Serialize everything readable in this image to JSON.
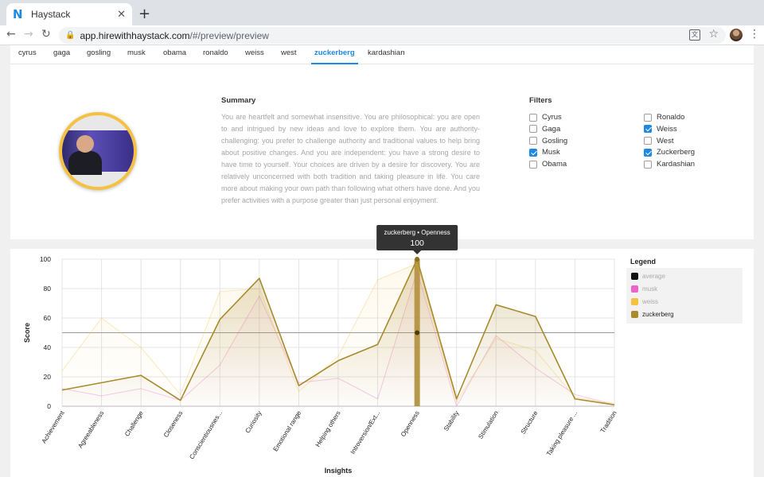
{
  "browser": {
    "tab_title": "Haystack",
    "tab_favicon": "N",
    "url_host": "app.hirewithhaystack.com",
    "url_path": "/#/preview/preview"
  },
  "celebrity_tabs": [
    "cyrus",
    "gaga",
    "gosling",
    "musk",
    "obama",
    "ronaldo",
    "weiss",
    "west",
    "zuckerberg",
    "kardashian"
  ],
  "active_tab": "zuckerberg",
  "summary": {
    "heading": "Summary",
    "text": "You are heartfelt and somewhat insensitive. You are philosophical: you are open to and intrigued by new ideas and love to explore them. You are authority-challenging: you prefer to challenge authority and traditional values to help bring about positive changes. And you are independent: you have a strong desire to have time to yourself. Your choices are driven by a desire for discovery. You are relatively unconcerned with both tradition and taking pleasure in life. You care more about making your own path than following what others have done. And you prefer activities with a purpose greater than just personal enjoyment."
  },
  "filters": {
    "heading": "Filters",
    "items": [
      {
        "label": "Cyrus",
        "checked": false
      },
      {
        "label": "Gaga",
        "checked": false
      },
      {
        "label": "Gosling",
        "checked": false
      },
      {
        "label": "Musk",
        "checked": true
      },
      {
        "label": "Obama",
        "checked": false
      },
      {
        "label": "Ronaldo",
        "checked": false
      },
      {
        "label": "Weiss",
        "checked": true
      },
      {
        "label": "West",
        "checked": false
      },
      {
        "label": "Zuckerberg",
        "checked": true
      },
      {
        "label": "Kardashian",
        "checked": false
      }
    ]
  },
  "legend": {
    "heading": "Legend",
    "items": [
      {
        "label": "average",
        "color": "#111111",
        "active": false
      },
      {
        "label": "musk",
        "color": "#e966c8",
        "active": false
      },
      {
        "label": "weiss",
        "color": "#f5c142",
        "active": false
      },
      {
        "label": "zuckerberg",
        "color": "#a98a2d",
        "active": true
      }
    ]
  },
  "tooltip": {
    "title": "zuckerberg • Openness",
    "value": "100"
  },
  "chart_data": {
    "type": "area",
    "xlabel": "Insights",
    "ylabel": "Score",
    "ylim": [
      0,
      100
    ],
    "yticks": [
      0,
      20,
      40,
      60,
      80,
      100
    ],
    "categories": [
      "Achievement",
      "Agreeableness",
      "Challenge",
      "Closeness",
      "Conscientiousnes...",
      "Curiosity",
      "Emotional range",
      "Helping others",
      "Introversion/Ext...",
      "Openness",
      "Stability",
      "Stimulation",
      "Structure",
      "Taking pleasure ...",
      "Tradition"
    ],
    "average": 50,
    "highlight_index": 9,
    "series": [
      {
        "name": "musk",
        "color": "#e966c8",
        "values": [
          12,
          7,
          12,
          4,
          28,
          75,
          16,
          19,
          5,
          92,
          0,
          48,
          26,
          8,
          1
        ]
      },
      {
        "name": "weiss",
        "color": "#f5c142",
        "values": [
          24,
          60,
          40,
          8,
          78,
          80,
          10,
          34,
          86,
          97,
          3,
          46,
          38,
          6,
          2
        ]
      },
      {
        "name": "zuckerberg",
        "color": "#a98a2d",
        "values": [
          11,
          16,
          21,
          4,
          59,
          87,
          14,
          31,
          42,
          100,
          5,
          69,
          61,
          5,
          1
        ]
      }
    ]
  }
}
